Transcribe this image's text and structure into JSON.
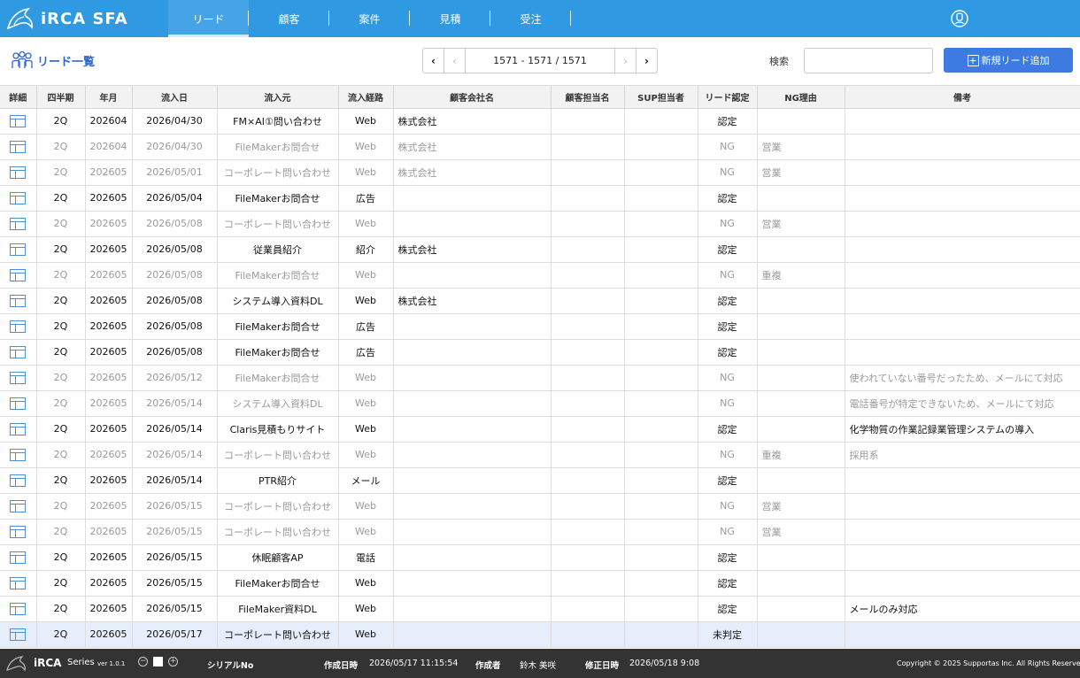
{
  "app": {
    "name": "iRCA SFA"
  },
  "nav": {
    "items": [
      {
        "label": "リード",
        "active": true
      },
      {
        "label": "顧客",
        "active": false
      },
      {
        "label": "案件",
        "active": false
      },
      {
        "label": "見積",
        "active": false
      },
      {
        "label": "受注",
        "active": false
      }
    ]
  },
  "toolbar": {
    "title": "リード一覧",
    "pager_text": "1571 - 1571 / 1571",
    "search_label": "検索",
    "search_value": "",
    "add_button": "新規リード追加"
  },
  "table": {
    "columns": [
      "詳細",
      "四半期",
      "年月",
      "流入日",
      "流入元",
      "流入経路",
      "顧客会社名",
      "顧客担当名",
      "SUP担当者",
      "リード認定",
      "NG理由",
      "備考"
    ],
    "rows": [
      {
        "q": "2Q",
        "ym": "202604",
        "date": "2026/04/30",
        "source": "FM×AI①問い合わせ",
        "route": "Web",
        "company": "株式会社",
        "contact": "",
        "sup": "",
        "status": "認定",
        "ng": "",
        "note": ""
      },
      {
        "q": "2Q",
        "ym": "202604",
        "date": "2026/04/30",
        "source": "FileMakerお問合せ",
        "route": "Web",
        "company": "株式会社",
        "contact": "",
        "sup": "",
        "status": "NG",
        "ng": "営業",
        "note": ""
      },
      {
        "q": "2Q",
        "ym": "202605",
        "date": "2026/05/01",
        "source": "コーポレート問い合わせ",
        "route": "Web",
        "company": "株式会社",
        "contact": "",
        "sup": "",
        "status": "NG",
        "ng": "営業",
        "note": ""
      },
      {
        "q": "2Q",
        "ym": "202605",
        "date": "2026/05/04",
        "source": "FileMakerお問合せ",
        "route": "広告",
        "company": "",
        "contact": "",
        "sup": "",
        "status": "認定",
        "ng": "",
        "note": ""
      },
      {
        "q": "2Q",
        "ym": "202605",
        "date": "2026/05/08",
        "source": "コーポレート問い合わせ",
        "route": "Web",
        "company": "",
        "contact": "",
        "sup": "",
        "status": "NG",
        "ng": "営業",
        "note": ""
      },
      {
        "q": "2Q",
        "ym": "202605",
        "date": "2026/05/08",
        "source": "従業員紹介",
        "route": "紹介",
        "company": "株式会社",
        "contact": "",
        "sup": "",
        "status": "認定",
        "ng": "",
        "note": ""
      },
      {
        "q": "2Q",
        "ym": "202605",
        "date": "2026/05/08",
        "source": "FileMakerお問合せ",
        "route": "Web",
        "company": "",
        "contact": "",
        "sup": "",
        "status": "NG",
        "ng": "重複",
        "note": ""
      },
      {
        "q": "2Q",
        "ym": "202605",
        "date": "2026/05/08",
        "source": "システム導入資料DL",
        "route": "Web",
        "company": "株式会社",
        "contact": "",
        "sup": "",
        "status": "認定",
        "ng": "",
        "note": ""
      },
      {
        "q": "2Q",
        "ym": "202605",
        "date": "2026/05/08",
        "source": "FileMakerお問合せ",
        "route": "広告",
        "company": "",
        "contact": "",
        "sup": "",
        "status": "認定",
        "ng": "",
        "note": ""
      },
      {
        "q": "2Q",
        "ym": "202605",
        "date": "2026/05/08",
        "source": "FileMakerお問合せ",
        "route": "広告",
        "company": "",
        "contact": "",
        "sup": "",
        "status": "認定",
        "ng": "",
        "note": ""
      },
      {
        "q": "2Q",
        "ym": "202605",
        "date": "2026/05/12",
        "source": "FileMakerお問合せ",
        "route": "Web",
        "company": "",
        "contact": "",
        "sup": "",
        "status": "NG",
        "ng": "",
        "note": "使われていない番号だったため、メールにて対応"
      },
      {
        "q": "2Q",
        "ym": "202605",
        "date": "2026/05/14",
        "source": "システム導入資料DL",
        "route": "Web",
        "company": "",
        "contact": "",
        "sup": "",
        "status": "NG",
        "ng": "",
        "note": "電話番号が特定できないため、メールにて対応"
      },
      {
        "q": "2Q",
        "ym": "202605",
        "date": "2026/05/14",
        "source": "Claris見積もりサイト",
        "route": "Web",
        "company": "",
        "contact": "",
        "sup": "",
        "status": "認定",
        "ng": "",
        "note": "化学物質の作業記録業管理システムの導入"
      },
      {
        "q": "2Q",
        "ym": "202605",
        "date": "2026/05/14",
        "source": "コーポレート問い合わせ",
        "route": "Web",
        "company": "",
        "contact": "",
        "sup": "",
        "status": "NG",
        "ng": "重複",
        "note": "採用系"
      },
      {
        "q": "2Q",
        "ym": "202605",
        "date": "2026/05/14",
        "source": "PTR紹介",
        "route": "メール",
        "company": "",
        "contact": "",
        "sup": "",
        "status": "認定",
        "ng": "",
        "note": ""
      },
      {
        "q": "2Q",
        "ym": "202605",
        "date": "2026/05/15",
        "source": "コーポレート問い合わせ",
        "route": "Web",
        "company": "",
        "contact": "",
        "sup": "",
        "status": "NG",
        "ng": "営業",
        "note": ""
      },
      {
        "q": "2Q",
        "ym": "202605",
        "date": "2026/05/15",
        "source": "コーポレート問い合わせ",
        "route": "Web",
        "company": "",
        "contact": "",
        "sup": "",
        "status": "NG",
        "ng": "営業",
        "note": ""
      },
      {
        "q": "2Q",
        "ym": "202605",
        "date": "2026/05/15",
        "source": "休眠顧客AP",
        "route": "電話",
        "company": "",
        "contact": "",
        "sup": "",
        "status": "認定",
        "ng": "",
        "note": ""
      },
      {
        "q": "2Q",
        "ym": "202605",
        "date": "2026/05/15",
        "source": "FileMakerお問合せ",
        "route": "Web",
        "company": "",
        "contact": "",
        "sup": "",
        "status": "認定",
        "ng": "",
        "note": ""
      },
      {
        "q": "2Q",
        "ym": "202605",
        "date": "2026/05/15",
        "source": "FileMaker資料DL",
        "route": "Web",
        "company": "",
        "contact": "",
        "sup": "",
        "status": "認定",
        "ng": "",
        "note": "メールのみ対応"
      },
      {
        "q": "2Q",
        "ym": "202605",
        "date": "2026/05/17",
        "source": "コーポレート問い合わせ",
        "route": "Web",
        "company": "",
        "contact": "",
        "sup": "",
        "status": "未判定",
        "ng": "",
        "note": "",
        "selected": true
      }
    ]
  },
  "footer": {
    "brand": "iRCA",
    "series": "Series",
    "version": "ver 1.0.1",
    "serial_label": "シリアルNo",
    "created_label": "作成日時",
    "created_value": "2026/05/17 11:15:54",
    "author_label": "作成者",
    "author_value": "鈴木 美咲",
    "modified_label": "修正日時",
    "modified_value": "2026/05/18 9:08",
    "copyright": "Copyright © 2025 Supportas Inc. All Rights Reserved."
  },
  "colors": {
    "topbar": "#2f9ae2",
    "accent": "#3d7be3",
    "title": "#2f67c9",
    "footer": "#333333",
    "selected_row": "#e6eefb"
  }
}
